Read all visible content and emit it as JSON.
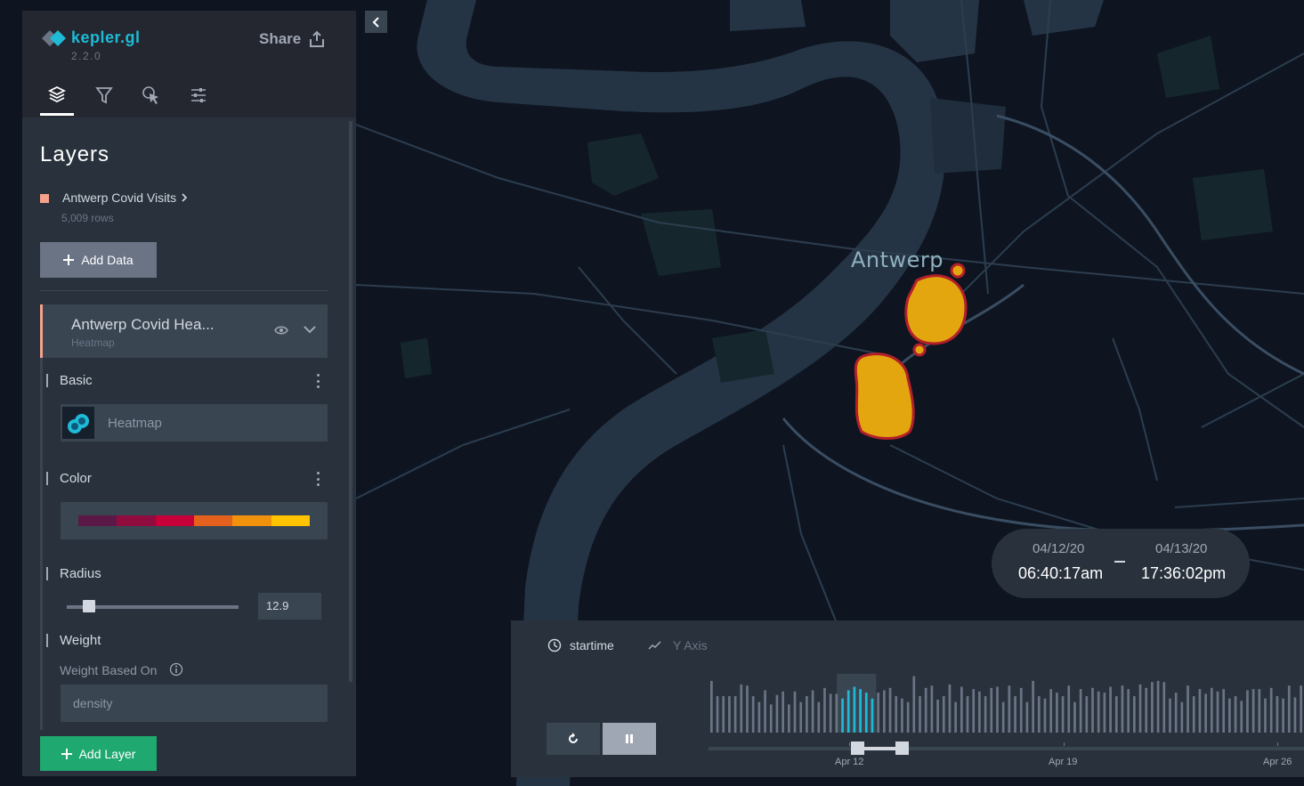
{
  "app": {
    "name": "kepler.gl",
    "version": "2.2.0",
    "share_label": "Share"
  },
  "tabs": [
    {
      "name": "layers-tab",
      "icon": "layers-icon",
      "active": true
    },
    {
      "name": "filters-tab",
      "icon": "filter-icon",
      "active": false
    },
    {
      "name": "interactions-tab",
      "icon": "pointer-icon",
      "active": false
    },
    {
      "name": "base-map-tab",
      "icon": "sliders-icon",
      "active": false
    }
  ],
  "panel": {
    "title": "Layers"
  },
  "dataset": {
    "name": "Antwerp Covid Visits",
    "rows": "5,009 rows",
    "color": "#f6a28b"
  },
  "buttons": {
    "add_data": "Add Data",
    "add_layer": "Add Layer"
  },
  "layer": {
    "name": "Antwerp Covid Hea...",
    "type": "Heatmap",
    "sections": {
      "basic": "Basic",
      "color": "Color",
      "radius": "Radius",
      "weight": "Weight",
      "weight_based_on": "Weight Based On"
    },
    "type_select": "Heatmap",
    "color_ramp": [
      "#5a1846",
      "#900c3f",
      "#c70039",
      "#e3611c",
      "#f1920e",
      "#ffc300"
    ],
    "radius": {
      "value": "12.9",
      "fraction": 0.13
    },
    "weight_field": "density"
  },
  "map": {
    "city_label": "Antwerp"
  },
  "time_window": {
    "start_date": "04/12/20",
    "start_time": "06:40:17am",
    "end_date": "04/13/20",
    "end_time": "17:36:02pm"
  },
  "timeline": {
    "field": "startime",
    "y_axis": "Y Axis",
    "ticks": [
      "Apr 12",
      "Apr 19",
      "Apr 26"
    ],
    "accent": "#1fbad6",
    "histogram": [
      0.88,
      0.62,
      0.62,
      0.62,
      0.62,
      0.82,
      0.8,
      0.62,
      0.52,
      0.72,
      0.48,
      0.64,
      0.7,
      0.48,
      0.7,
      0.52,
      0.62,
      0.72,
      0.52,
      0.76,
      0.66,
      0.66,
      0.58,
      0.72,
      0.78,
      0.74,
      0.68,
      0.58,
      0.68,
      0.72,
      0.76,
      0.62,
      0.58,
      0.52,
      0.96,
      0.62,
      0.76,
      0.8,
      0.56,
      0.62,
      0.82,
      0.52,
      0.78,
      0.62,
      0.74,
      0.7,
      0.62,
      0.76,
      0.78,
      0.52,
      0.8,
      0.62,
      0.76,
      0.52,
      0.88,
      0.62,
      0.58,
      0.74,
      0.68,
      0.62,
      0.8,
      0.52,
      0.74,
      0.62,
      0.76,
      0.7,
      0.68,
      0.78,
      0.62,
      0.8,
      0.74,
      0.62,
      0.82,
      0.76,
      0.86,
      0.88,
      0.86,
      0.58,
      0.68,
      0.52,
      0.8,
      0.62,
      0.74,
      0.66,
      0.76,
      0.7,
      0.74,
      0.58,
      0.62,
      0.54,
      0.72,
      0.74,
      0.74,
      0.58,
      0.76,
      0.62,
      0.58,
      0.8,
      0.6,
      0.8
    ],
    "selected_range": [
      22,
      27
    ]
  }
}
